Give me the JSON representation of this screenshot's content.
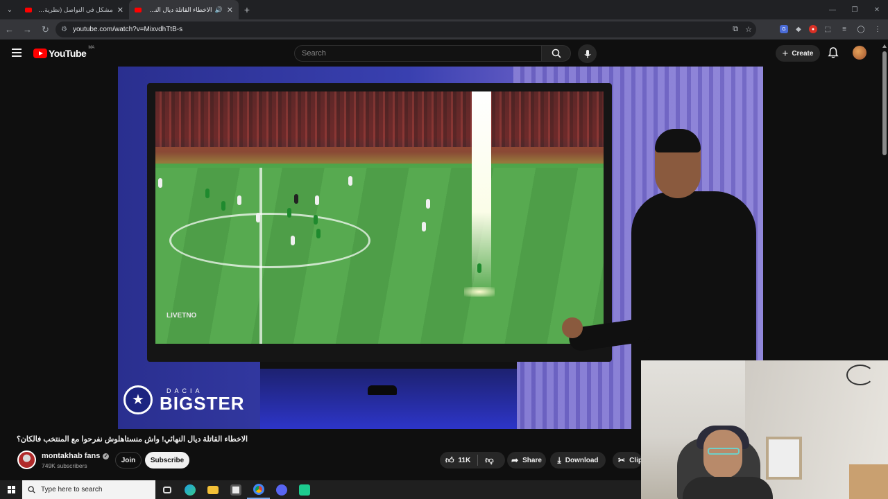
{
  "browser": {
    "tabs": [
      {
        "title": "مشكل في التواصل (نظرية البراكة)…",
        "active": false
      },
      {
        "title": "الاخطاء القاتلة ديال النهائي!…",
        "active": true
      }
    ],
    "new_tab": "+",
    "url": "youtube.com/watch?v=MixvdhTtB-s"
  },
  "youtube": {
    "logo": "YouTube",
    "region": "MA",
    "search_placeholder": "Search",
    "create_label": "Create"
  },
  "video": {
    "watermark": "LIVETNO",
    "sponsor_small": "DACIA",
    "sponsor_large": "BIGSTER",
    "title": "الاخطاء القاتلة ديال النهائي! واش منستاهلوش نفرحوا مع المنتخب فالكان؟",
    "channel_name": "montakhab fans",
    "subscribers": "749K subscribers",
    "join_label": "Join",
    "subscribe_label": "Subscribe",
    "like_count": "11K",
    "share_label": "Share",
    "download_label": "Download",
    "clip_label": "Clip"
  },
  "taskbar": {
    "search_placeholder": "Type here to search"
  },
  "colors": {
    "youtube_red": "#ff0000",
    "background": "#0f0f0f",
    "pill_bg": "#272727"
  }
}
